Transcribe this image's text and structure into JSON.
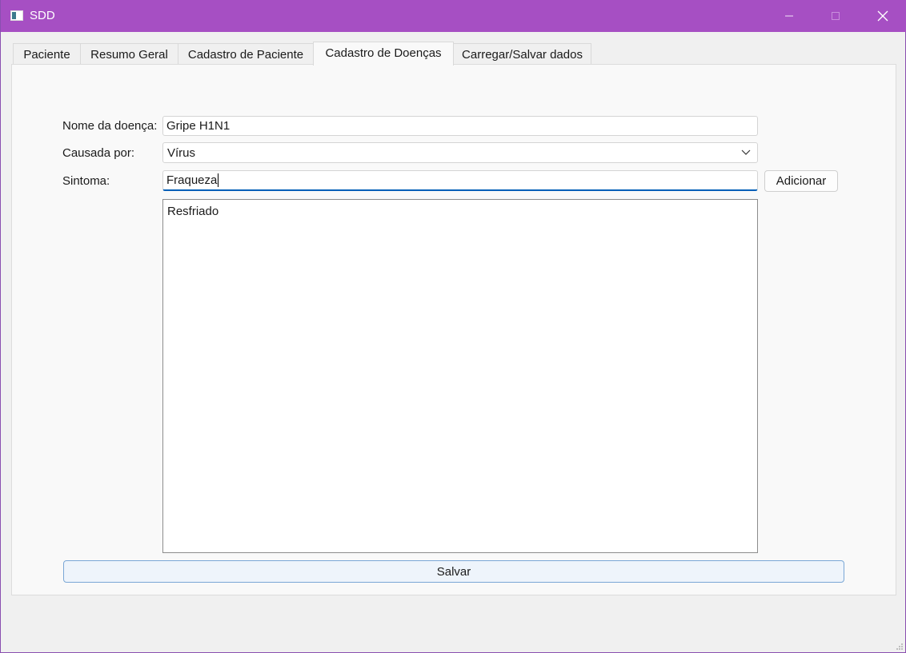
{
  "window": {
    "title": "SDD",
    "accent_color": "#a64fc3",
    "controls": [
      "minimize-icon",
      "maximize-icon",
      "close-icon"
    ]
  },
  "tabs": [
    {
      "label": "Paciente",
      "active": false
    },
    {
      "label": "Resumo Geral",
      "active": false
    },
    {
      "label": "Cadastro de Paciente",
      "active": false
    },
    {
      "label": "Cadastro de Doenças",
      "active": true
    },
    {
      "label": "Carregar/Salvar dados",
      "active": false
    }
  ],
  "form": {
    "disease_name": {
      "label": "Nome da doença:",
      "value": "Gripe H1N1"
    },
    "caused_by": {
      "label": "Causada por:",
      "value": "Vírus"
    },
    "symptom": {
      "label": "Sintoma:",
      "value": "Fraqueza"
    },
    "add_button": "Adicionar",
    "symptom_list": [
      "Resfriado"
    ],
    "save_button": "Salvar"
  }
}
